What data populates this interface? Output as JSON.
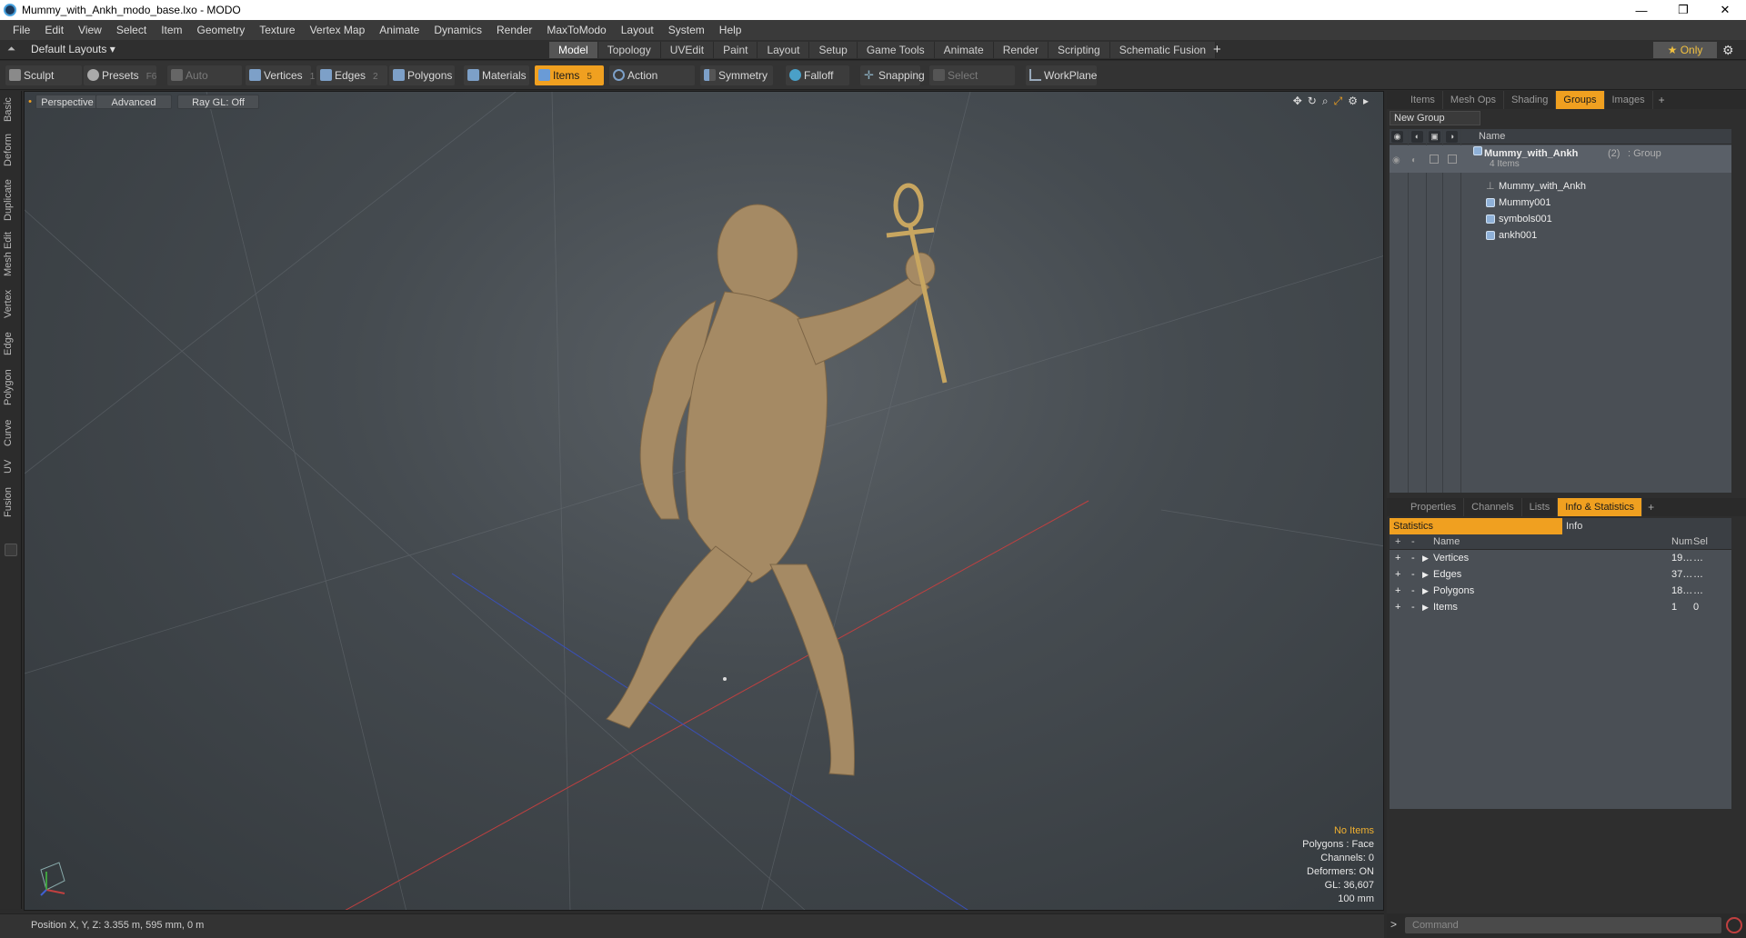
{
  "window": {
    "title": "Mummy_with_Ankh_modo_base.lxo - MODO",
    "controls": [
      "—",
      "❐",
      "✕"
    ]
  },
  "menu": [
    "File",
    "Edit",
    "View",
    "Select",
    "Item",
    "Geometry",
    "Texture",
    "Vertex Map",
    "Animate",
    "Dynamics",
    "Render",
    "MaxToModo",
    "Layout",
    "System",
    "Help"
  ],
  "layoutbar": {
    "layout_dropdown": "Default Layouts ▾",
    "tabs": [
      "Model",
      "Topology",
      "UVEdit",
      "Paint",
      "Layout",
      "Setup",
      "Game Tools",
      "Animate",
      "Render",
      "Scripting",
      "Schematic Fusion"
    ],
    "active_tab": "Model",
    "plus": "+",
    "only_label": "★  Only",
    "gear": "⚙"
  },
  "toolbar": {
    "sculpt": "Sculpt",
    "presets": "Presets",
    "presets_key": "F6",
    "auto_select": "Auto Select",
    "vertices": "Vertices",
    "vertices_key": "1",
    "edges": "Edges",
    "edges_key": "2",
    "polygons": "Polygons",
    "materials": "Materials",
    "items": "Items",
    "items_key": "5",
    "action_center": "Action Center",
    "symmetry": "Symmetry",
    "falloff": "Falloff",
    "snapping": "Snapping",
    "select_through": "Select Through",
    "workplane": "WorkPlane"
  },
  "left_tabs": [
    "Basic",
    "Deform",
    "Duplicate",
    "Mesh Edit",
    "Vertex",
    "Edge",
    "Polygon",
    "Curve",
    "UV",
    "Fusion"
  ],
  "viewport": {
    "view_mode": "Perspective",
    "shading": "Advanced",
    "raygl": "Ray GL: Off",
    "info": {
      "selection": "No Items",
      "polygons": "Polygons : Face",
      "channels": "Channels: 0",
      "deformers": "Deformers: ON",
      "gl": "GL: 36,607",
      "scale": "100 mm"
    }
  },
  "top_panel": {
    "tabs": [
      "Items",
      "Mesh Ops",
      "Shading",
      "Groups",
      "Images"
    ],
    "active_tab": "Groups",
    "new_group": "New Group",
    "column_name": "Name",
    "group": {
      "name": "Mummy_with_Ankh",
      "count": "(2)",
      "type": ": Group",
      "items_count": "4 Items"
    },
    "items": [
      "Mummy_with_Ankh",
      "Mummy001",
      "symbols001",
      "ankh001"
    ]
  },
  "bottom_panel": {
    "tabs": [
      "Properties",
      "Channels",
      "Lists",
      "Info & Statistics"
    ],
    "active_tab": "Info & Statistics",
    "sub_tabs": {
      "statistics": "Statistics",
      "info": "Info"
    },
    "columns": {
      "name": "Name",
      "num": "Num",
      "sel": "Sel"
    },
    "rows": [
      {
        "name": "Vertices",
        "num": "19…",
        "sel": "…"
      },
      {
        "name": "Edges",
        "num": "37…",
        "sel": "…"
      },
      {
        "name": "Polygons",
        "num": "18…",
        "sel": "…"
      },
      {
        "name": "Items",
        "num": "1",
        "sel": "0"
      }
    ]
  },
  "command": {
    "prompt": ">",
    "placeholder": "Command"
  },
  "status": {
    "position": "Position X, Y, Z:   3.355 m, 595 mm, 0 m"
  }
}
